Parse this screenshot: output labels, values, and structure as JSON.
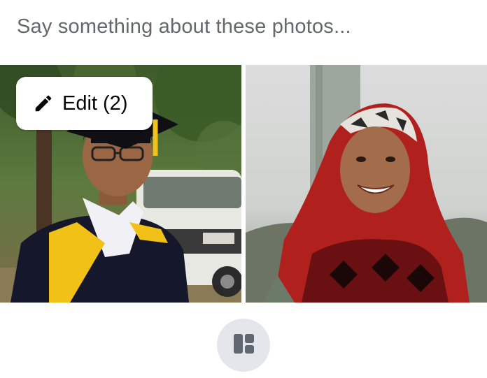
{
  "composer": {
    "placeholder": "Say something about these photos..."
  },
  "photos": [
    {
      "subject": "graduate-in-gown"
    },
    {
      "subject": "smiling-woman-in-red-scarf"
    }
  ],
  "edit_button": {
    "label": "Edit (2)",
    "icon": "pencil-icon"
  },
  "layout_button": {
    "icon": "layout-grid-icon"
  },
  "colors": {
    "placeholder_text": "#65676b",
    "button_bg": "#e4e6eb",
    "icon_dark": "#050505",
    "layout_icon": "#606770"
  }
}
